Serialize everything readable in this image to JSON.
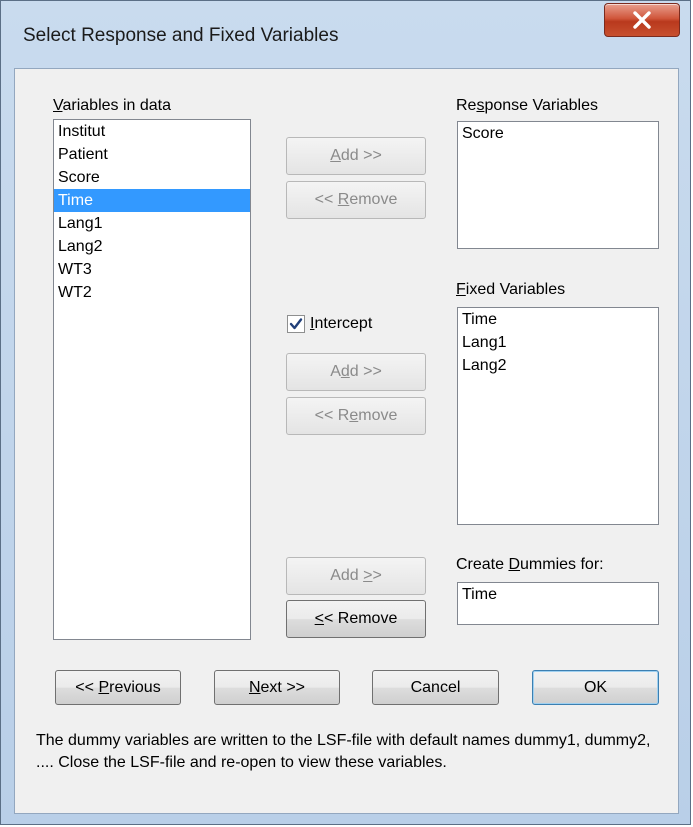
{
  "window": {
    "title": "Select Response and Fixed Variables"
  },
  "variables_in_data": {
    "label_pre": "",
    "label_key": "V",
    "label_post": "ariables in data",
    "items": [
      "Institut",
      "Patient",
      "Score",
      "Time",
      "Lang1",
      "Lang2",
      "WT3",
      "WT2"
    ],
    "selected": "Time"
  },
  "response": {
    "label_pre": "Re",
    "label_key": "s",
    "label_post": "ponse Variables",
    "items": [
      "Score"
    ],
    "add": {
      "pre": "",
      "key": "A",
      "post": "dd >>"
    },
    "remove": {
      "pre": "<< ",
      "key": "R",
      "post": "emove"
    }
  },
  "fixed": {
    "label_pre": "",
    "label_key": "F",
    "label_post": "ixed Variables",
    "items": [
      "Time",
      "Lang1",
      "Lang2"
    ],
    "intercept": {
      "pre": "",
      "key": "I",
      "post": "ntercept",
      "checked": true
    },
    "add": {
      "pre": "A",
      "key": "d",
      "post": "d >>"
    },
    "remove": {
      "pre": "<< R",
      "key": "e",
      "post": "move"
    }
  },
  "dummies": {
    "label_pre": "Create ",
    "label_key": "D",
    "label_post": "ummies for:",
    "items": [
      "Time"
    ],
    "add": {
      "pre": "Add ",
      "key": ">",
      "post": ">"
    },
    "remove": {
      "pre": "",
      "key": "<",
      "post": "< Remove"
    }
  },
  "buttons": {
    "previous": {
      "pre": "<< ",
      "key": "P",
      "post": "revious"
    },
    "next": {
      "pre": "",
      "key": "N",
      "post": "ext >>"
    },
    "cancel": "Cancel",
    "ok": "OK"
  },
  "note": "The dummy variables are written to the LSF-file with default names dummy1, dummy2, .... Close the LSF-file and re-open to view these variables."
}
